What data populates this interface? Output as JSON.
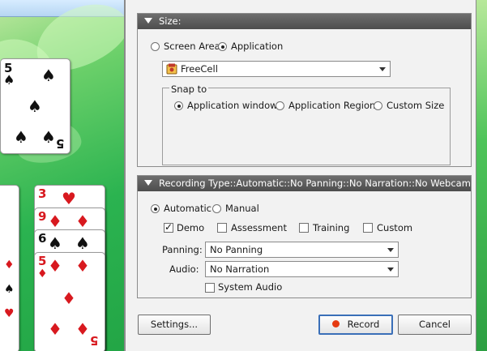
{
  "size_panel": {
    "header": "Size:",
    "screen_area_label": "Screen Area",
    "application_label": "Application",
    "selected": "Application",
    "application_value": "FreeCell",
    "snap_to": {
      "legend": "Snap to",
      "options": [
        "Application window",
        "Application Region",
        "Custom Size"
      ],
      "selected": "Application window"
    }
  },
  "recording_panel": {
    "header": "Recording Type::Automatic::No Panning::No Narration::No Webcam",
    "automatic_label": "Automatic",
    "manual_label": "Manual",
    "mode_selected": "Automatic",
    "checks": [
      {
        "label": "Demo",
        "checked": true
      },
      {
        "label": "Assessment",
        "checked": false
      },
      {
        "label": "Training",
        "checked": false
      },
      {
        "label": "Custom",
        "checked": false
      }
    ],
    "panning_label": "Panning:",
    "panning_value": "No Panning",
    "audio_label": "Audio:",
    "audio_value": "No Narration",
    "system_audio_label": "System Audio",
    "system_audio_checked": false
  },
  "buttons": {
    "settings": "Settings...",
    "record": "Record",
    "cancel": "Cancel"
  },
  "background_cards": {
    "card1": {
      "rank": "5",
      "suit": "♠"
    },
    "column": [
      {
        "rank": "3",
        "suit": "♥"
      },
      {
        "rank": "9",
        "suit": "♦"
      },
      {
        "rank": "6",
        "suit": "♠"
      },
      {
        "rank": "5",
        "suit": "♦"
      }
    ]
  },
  "colors": {
    "panel_header": "#555555",
    "record_dot": "#e53a12",
    "default_button_border": "#3a6fb8",
    "felt_green": "#2bb350"
  }
}
